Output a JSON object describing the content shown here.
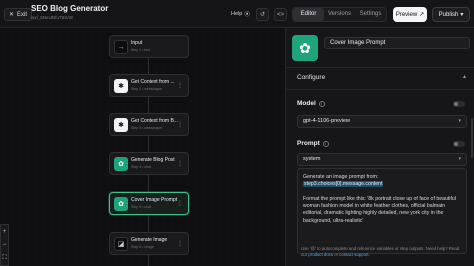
{
  "topbar": {
    "exit_label": "Exit",
    "title": "SEO Blog Generator",
    "subtitle": "wxf_5NmJDfuT6XAE",
    "help_label": "Help",
    "views": [
      "Editor",
      "Versions",
      "Settings"
    ],
    "active_view": "Editor",
    "preview_label": "Preview",
    "publish_label": "Publish"
  },
  "canvas": {
    "nodes": [
      {
        "title": "Input",
        "sub": "Step 1 • text",
        "icon": "input-arrow-icon"
      },
      {
        "title": "Get Context from ...",
        "sub": "Step 2 • webscraper",
        "icon": "webscraper-icon"
      },
      {
        "title": "Get Context from B...",
        "sub": "Step 3 • webscraper",
        "icon": "webscraper-icon"
      },
      {
        "title": "Generate Blog Post",
        "sub": "Step 4 • chat",
        "icon": "openai-icon"
      },
      {
        "title": "Cover Image Prompt",
        "sub": "Step 5 • chat",
        "icon": "openai-icon"
      },
      {
        "title": "Generate Image",
        "sub": "Step 6 • image",
        "icon": "image-gen-icon"
      }
    ],
    "selected_node": 4
  },
  "panel": {
    "node_name": "Cover Image Prompt",
    "section_title": "Configure",
    "model_label": "Model",
    "model_value": "gpt-4-1106-preview",
    "prompt_label": "Prompt",
    "role_value": "system",
    "prompt_line1": "Generate an image prompt from:",
    "prompt_variable": "step3.choices[0].message.content",
    "prompt_body": "Format the prompt like this: '8k portrait close up of face of beautiful woman fashion model in white feather clothes, official balmain editorial, dramatic lighting highly detailed, new york city in the background, ultra-realistic'",
    "help_prefix": "Use '@' to autocomplete and reference variables or step outputs. Need help? Read our ",
    "help_link1": "product docs",
    "help_mid": " or ",
    "help_link2": "contact support",
    "help_suffix": "."
  },
  "colors": {
    "accent_green": "#1fa37a",
    "selected_border": "#3fbf8a",
    "variable_highlight": "#1f4f63"
  }
}
